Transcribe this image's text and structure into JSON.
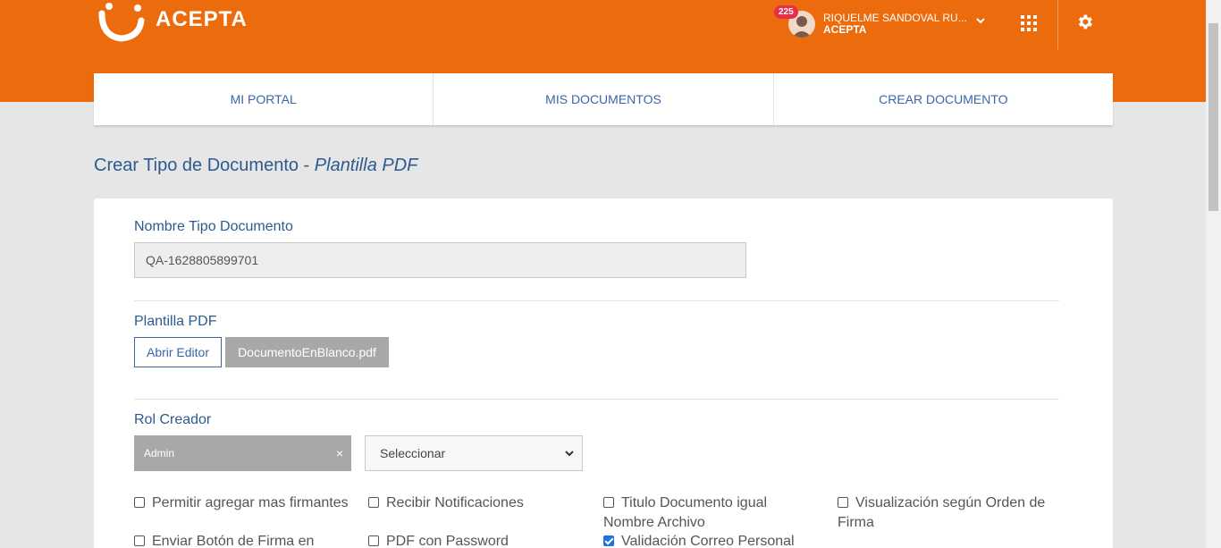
{
  "brand": {
    "name": "ACEPTA",
    "accent": "#ec6b0d",
    "link_color": "#3a66a8"
  },
  "header": {
    "notification_count": "225",
    "user_name": "RIQUELME SANDOVAL RU...",
    "user_org": "ACEPTA",
    "icons": [
      "chevron-down-icon",
      "apps-grid-icon",
      "gear-icon"
    ]
  },
  "nav": {
    "tabs": [
      {
        "label": "MI PORTAL"
      },
      {
        "label": "MIS DOCUMENTOS"
      },
      {
        "label": "CREAR DOCUMENTO"
      }
    ]
  },
  "page": {
    "title_prefix": "Crear Tipo de Documento - ",
    "title_emphasis": "Plantilla PDF"
  },
  "form": {
    "name_label": "Nombre Tipo Documento",
    "name_value": "QA-1628805899701",
    "template_label": "Plantilla PDF",
    "open_editor_label": "Abrir Editor",
    "file_name": "DocumentoEnBlanco.pdf",
    "role_label": "Rol Creador",
    "role_tag": "Admin",
    "role_tag_remove": "×",
    "role_select_value": "Seleccionar",
    "checkboxes": [
      {
        "label": "Permitir agregar mas firmantes",
        "checked": false
      },
      {
        "label": "Recibir Notificaciones",
        "checked": false
      },
      {
        "label": "Titulo Documento igual",
        "label2": "Nombre Archivo",
        "checked": false
      },
      {
        "label": "Visualización según Orden de",
        "label2": "Firma",
        "checked": false
      },
      {
        "label": "Enviar Botón de Firma en",
        "checked": false
      },
      {
        "label": "PDF con Password",
        "checked": false
      },
      {
        "label": "Validación Correo Personal",
        "checked": true
      }
    ]
  }
}
